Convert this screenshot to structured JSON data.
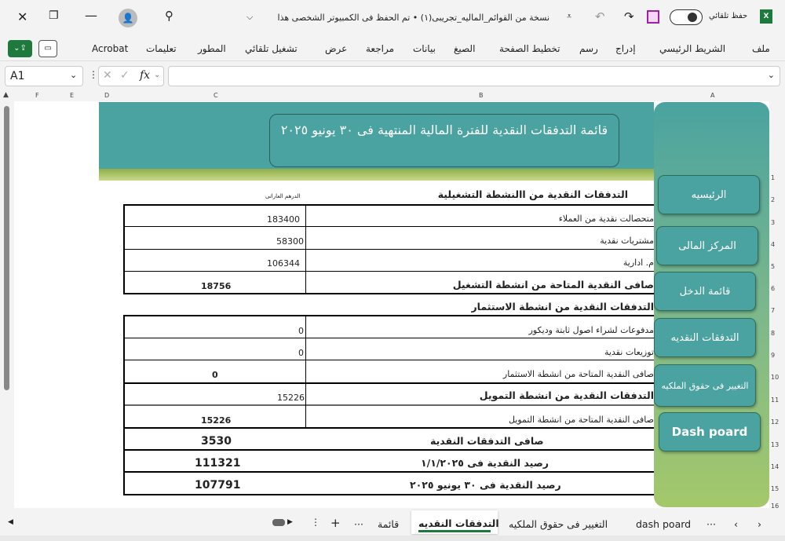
{
  "titlebar": {
    "autosave_label": "حفظ تلقائي",
    "doc_title": "نسخة من القوائم_الماليه_تجريبى(١) • تم الحفظ فى الكمبيوتر الشخصى هذا"
  },
  "ribbon": {
    "tabs": [
      "ملف",
      "الشريط الرئيسي",
      "إدراج",
      "رسم",
      "تخطيط الصفحة",
      "الصيغ",
      "بيانات",
      "مراجعة",
      "عرض",
      "تشغيل تلقائي",
      "المطور",
      "تعليمات",
      "Acrobat"
    ]
  },
  "formula_bar": {
    "name_box": "A1",
    "fx": "fx",
    "formula": ""
  },
  "columns": [
    "A",
    "B",
    "C",
    "D",
    "E",
    "F"
  ],
  "rows": [
    "1",
    "2",
    "3",
    "4",
    "5",
    "6",
    "7",
    "8",
    "9",
    "10",
    "11",
    "12",
    "13",
    "14",
    "15",
    "16"
  ],
  "sheet": {
    "title": "قائمة التدفقات النقدية للفترة المالية المنتهية فى ٣٠ يونيو ٢٠٢٥",
    "currency": "الدرهم العاراتى",
    "op_header": "التدفقات النقدية من االنشطة التشغيلية",
    "op_items": [
      {
        "label": "متحصالت نقدية من العملاء",
        "value": "183400"
      },
      {
        "label": "مشتريات نقدية",
        "value": "58300"
      },
      {
        "label": "م. ادارية",
        "value": "106344"
      }
    ],
    "op_net": {
      "label": "صافى النقدية المتاحة من انشطة التشغيل",
      "value": "18756"
    },
    "inv_header": "التدفقات النقدية من انشطة الاستثمار",
    "inv_items": [
      {
        "label": "مدفوعات لشراء اصول ثابتة وديكور",
        "value": "0"
      },
      {
        "label": "توزيعات نقدية",
        "value": "0"
      }
    ],
    "inv_net": {
      "label": "صافى النقدية المتاحة من انشطة الاستثمار",
      "value": "0"
    },
    "fin_header": {
      "label": "التدفقات النقدية من انشطة التمويل",
      "value": "15226"
    },
    "fin_net": {
      "label": "صافى النقدية المتاحة من انشطة التمويل",
      "value": "15226"
    },
    "net_flow": {
      "label": "صافى التدفقات النقدية",
      "value": "3530"
    },
    "open_bal": {
      "label": "رصيد النقدية فى ١/١/٢٠٢٥",
      "value": "111321"
    },
    "close_bal": {
      "label": "رصيد النقدية فى ٣٠ يونيو ٢٠٢٥",
      "value": "107791"
    }
  },
  "nav": [
    "الرئيسيه",
    "المركز المالى",
    "قائمة الدخل",
    "التدفقات النقديه",
    "التغيير فى حقوق الملكيه",
    "Dash poard"
  ],
  "sheet_tabs": {
    "tabs": [
      "dash poard",
      "التغيير فى حقوق الملكيه",
      "التدفقات النقديه",
      "قائمة"
    ],
    "active": "التدفقات النقديه",
    "more": "···",
    "add": "+"
  },
  "colors": {
    "teal": "#4aa3a0",
    "excel_green": "#1e7a3c"
  }
}
